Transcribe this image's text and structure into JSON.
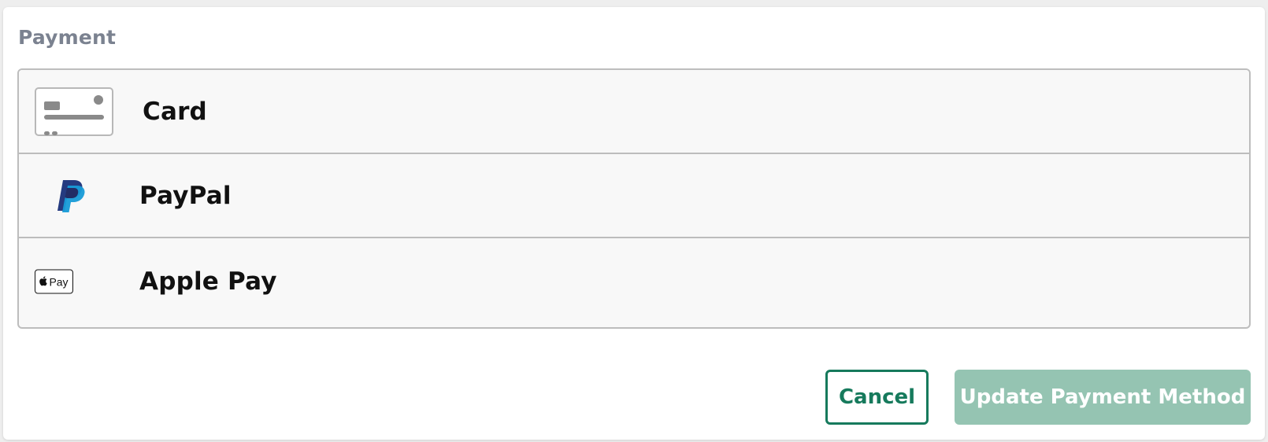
{
  "payment": {
    "title": "Payment",
    "methods": [
      {
        "label": "Card",
        "icon": "credit-card-icon"
      },
      {
        "label": "PayPal",
        "icon": "paypal-icon"
      },
      {
        "label": "Apple Pay",
        "icon": "apple-pay-icon",
        "icon_text": "Pay"
      }
    ]
  },
  "actions": {
    "cancel_label": "Cancel",
    "update_label": "Update Payment Method"
  },
  "colors": {
    "accent": "#167a5c",
    "accent_disabled": "#95c4b2",
    "title_gray": "#7b8290",
    "row_background": "#f8f8f8",
    "border": "#bdbdbd"
  }
}
